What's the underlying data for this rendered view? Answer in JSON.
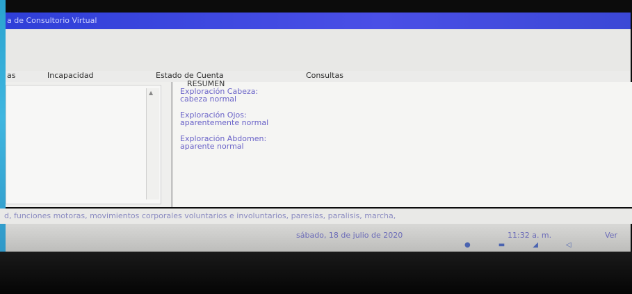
{
  "window": {
    "title": "a de Consultorio Virtual"
  },
  "tabs": [
    {
      "label": "as"
    },
    {
      "label": "Incapacidad"
    },
    {
      "label": "Estado de Cuenta"
    },
    {
      "label": "Consultas"
    }
  ],
  "resumen": {
    "header": "RESUMEN",
    "sections": [
      {
        "title": "Exploración Cabeza:",
        "value": "cabeza normal"
      },
      {
        "title": "Exploración Ojos:",
        "value": "aparentemente normal"
      },
      {
        "title": "Exploración Abdomen:",
        "value": "aparente normal"
      }
    ]
  },
  "hint": {
    "text": "d, funciones motoras, movimientos corporales voluntarios e involuntarios, paresias, paralisis, marcha,"
  },
  "status": {
    "date": "sábado, 18 de julio de 2020",
    "time": "11:32 a. m.",
    "extra": "Ver"
  },
  "colors": {
    "title_bar": "#3b48d6",
    "resumen_text": "#6a63c8",
    "desktop_edge": "#3fb6e0"
  },
  "icons": {
    "taskbar": [
      "network-globe-icon",
      "app-icon",
      "app-icon",
      "volume-icon"
    ]
  }
}
